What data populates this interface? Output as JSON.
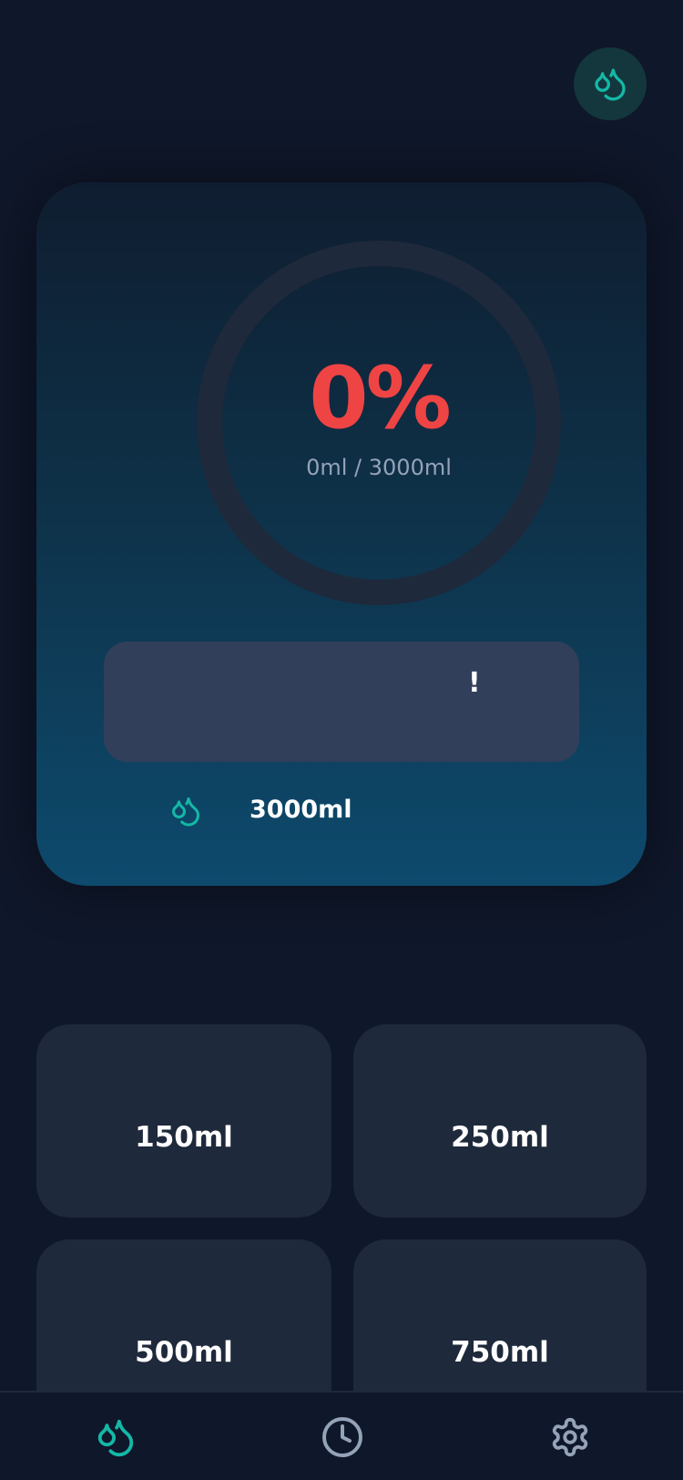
{
  "header": {
    "action_icon": "water-drops-icon"
  },
  "progress": {
    "percent_label": "0%",
    "percent_value": 0,
    "amount_label": "0ml / 3000ml",
    "ring_track_color": "#1e293b",
    "ring_fill_color": "#2dd4bf",
    "percent_color": "#ef4444"
  },
  "message": {
    "text": "!"
  },
  "goal": {
    "icon": "water-drops-icon",
    "label": "3000ml"
  },
  "quick_add": [
    {
      "label": "150ml"
    },
    {
      "label": "250ml"
    },
    {
      "label": "500ml"
    },
    {
      "label": "750ml"
    }
  ],
  "nav": {
    "items": [
      {
        "icon": "water-drops-icon",
        "active": true
      },
      {
        "icon": "clock-icon",
        "active": false
      },
      {
        "icon": "gear-icon",
        "active": false
      }
    ],
    "active_color": "#14b8a6",
    "inactive_color": "#94a3b8"
  },
  "colors": {
    "accent": "#14b8a6",
    "background": "#0f172a",
    "tile": "#1e293b"
  }
}
